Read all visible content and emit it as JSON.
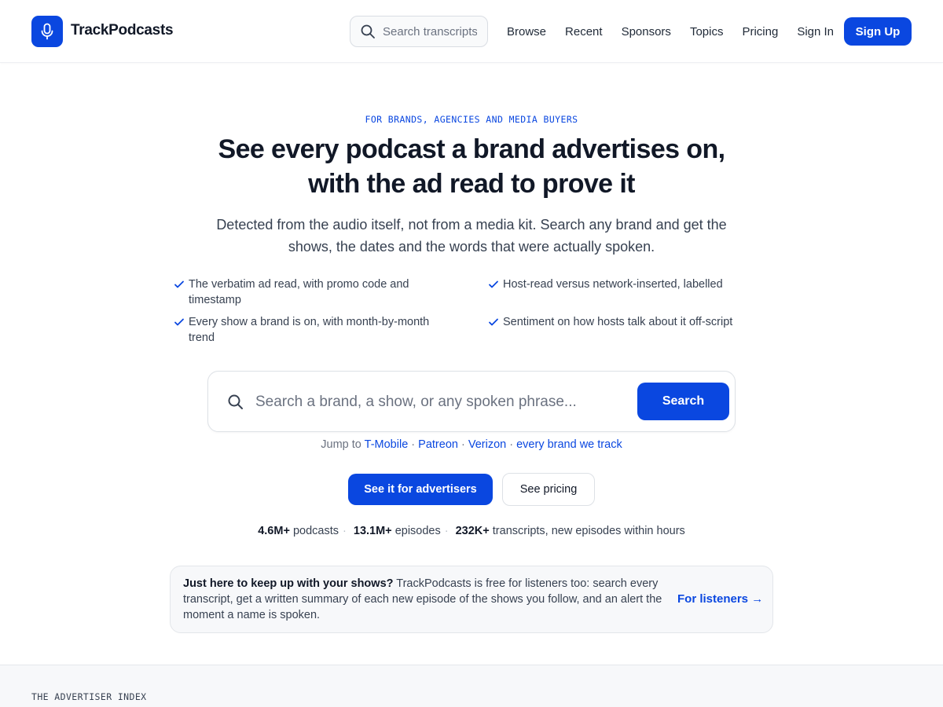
{
  "brand": {
    "name": "TrackPodcasts",
    "accent": "#0a47e0"
  },
  "nav": {
    "search_placeholder": "Search transcripts",
    "links": [
      "Browse",
      "Recent",
      "Sponsors",
      "Topics",
      "Pricing",
      "Sign In"
    ],
    "signup_label": "Sign Up"
  },
  "hero": {
    "eyebrow": "FOR BRANDS, AGENCIES AND MEDIA BUYERS",
    "headline_line1": "See every podcast a brand advertises on,",
    "headline_line2": "with the ad read to prove it",
    "subhead": "Detected from the audio itself, not from a media kit. Search any brand and get the shows, the dates and the words that were actually spoken.",
    "features": [
      "The verbatim ad read, with promo code and timestamp",
      "Host-read versus network-inserted, labelled",
      "Every show a brand is on, with month-by-month trend",
      "Sentiment on how hosts talk about it off-script"
    ]
  },
  "search": {
    "placeholder": "Search a brand, a show, or any spoken phrase...",
    "button_label": "Search",
    "jump_prefix": "Jump to",
    "jump_links": [
      "T-Mobile",
      "Patreon",
      "Verizon",
      "every brand we track"
    ]
  },
  "cta": {
    "primary_label": "See it for advertisers",
    "secondary_label": "See pricing"
  },
  "stats": [
    {
      "value": "4.6M+",
      "label": "podcasts"
    },
    {
      "value": "13.1M+",
      "label": "episodes"
    },
    {
      "value": "232K+",
      "label": "transcripts, new episodes within hours"
    }
  ],
  "listener_box": {
    "bold": "Just here to keep up with your shows?",
    "text": " TrackPodcasts is free for listeners too: search every transcript, get a written summary of each new episode of the shows you follow, and an alert the moment a name is spoken.",
    "link_label": "For listeners →"
  },
  "index_section": {
    "label": "THE ADVERTISER INDEX"
  }
}
